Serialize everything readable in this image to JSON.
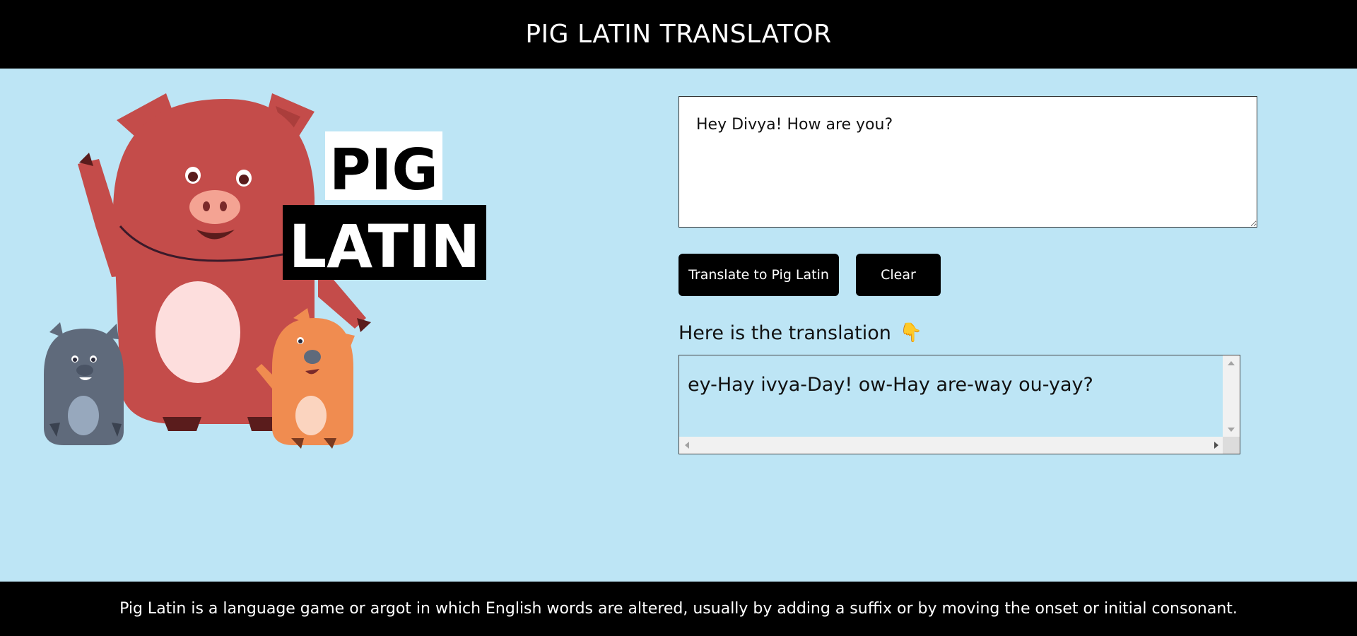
{
  "header": {
    "title": "PIG LATIN TRANSLATOR"
  },
  "logo": {
    "line1": "PIG",
    "line2": "LATIN"
  },
  "input": {
    "value": "Hey Divya! How are you?"
  },
  "buttons": {
    "translate": "Translate to Pig Latin",
    "clear": "Clear"
  },
  "result": {
    "label": "Here is the translation",
    "emoji": "👇",
    "text": "ey-Hay ivya-Day! ow-Hay are-way ou-yay?"
  },
  "footer": {
    "text": "Pig Latin is a language game or argot in which English words are altered, usually by adding a suffix or by moving the onset or initial consonant."
  },
  "colors": {
    "background": "#bde5f5",
    "header_footer": "#000000",
    "pig_big": "#c44c4a",
    "pig_small_grey": "#5f6a7b",
    "pig_small_orange": "#f08c50"
  }
}
